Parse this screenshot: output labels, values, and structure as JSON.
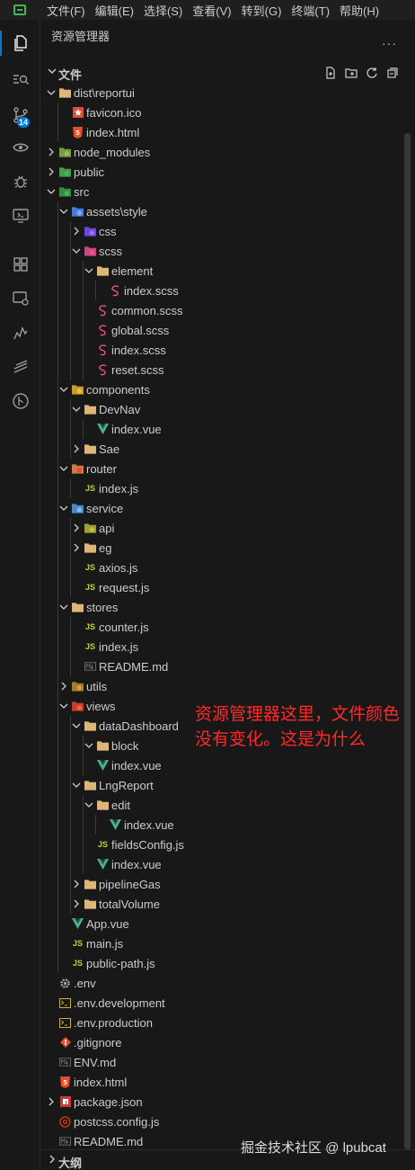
{
  "menubar": {
    "items": [
      "文件(F)",
      "编辑(E)",
      "选择(S)",
      "查看(V)",
      "转到(G)",
      "终端(T)",
      "帮助(H)"
    ]
  },
  "activitybar": {
    "items": [
      {
        "name": "explorer-icon",
        "active": true
      },
      {
        "name": "search-icon"
      },
      {
        "name": "source-control-icon",
        "badge": "14"
      },
      {
        "name": "eye-icon"
      },
      {
        "name": "debug-icon"
      },
      {
        "name": "remote-explorer-icon"
      },
      {
        "name": "extensions-icon"
      },
      {
        "name": "remote-window-icon"
      },
      {
        "name": "chart-icon"
      },
      {
        "name": "layers-icon"
      },
      {
        "name": "git-graph-icon"
      }
    ]
  },
  "sidebar": {
    "title": "资源管理器",
    "more": "···",
    "section_title": "文件",
    "outline_title": "大纲"
  },
  "colors": {
    "accent": "#0078d4",
    "folder": "#dcb67a",
    "vue": "#42b883",
    "js": "#cbcb41",
    "scss": "#f55385",
    "html": "#e44d26",
    "annotation": "#ff2a2a"
  },
  "tree": [
    {
      "label": "dist\\reportui",
      "depth": 0,
      "type": "folder",
      "open": true,
      "icon": "folder"
    },
    {
      "label": "favicon.ico",
      "depth": 1,
      "type": "file",
      "icon": "favicon"
    },
    {
      "label": "index.html",
      "depth": 1,
      "type": "file",
      "icon": "html"
    },
    {
      "label": "node_modules",
      "depth": 0,
      "type": "folder",
      "open": false,
      "icon": "folder-node"
    },
    {
      "label": "public",
      "depth": 0,
      "type": "folder",
      "open": false,
      "icon": "folder-public"
    },
    {
      "label": "src",
      "depth": 0,
      "type": "folder",
      "open": true,
      "icon": "folder-src"
    },
    {
      "label": "assets\\style",
      "depth": 1,
      "type": "folder",
      "open": true,
      "icon": "folder-assets"
    },
    {
      "label": "css",
      "depth": 2,
      "type": "folder",
      "open": false,
      "icon": "folder-css"
    },
    {
      "label": "scss",
      "depth": 2,
      "type": "folder",
      "open": true,
      "icon": "folder-scss"
    },
    {
      "label": "element",
      "depth": 3,
      "type": "folder",
      "open": true,
      "icon": "folder"
    },
    {
      "label": "index.scss",
      "depth": 4,
      "type": "file",
      "icon": "scss"
    },
    {
      "label": "common.scss",
      "depth": 3,
      "type": "file",
      "icon": "scss"
    },
    {
      "label": "global.scss",
      "depth": 3,
      "type": "file",
      "icon": "scss"
    },
    {
      "label": "index.scss",
      "depth": 3,
      "type": "file",
      "icon": "scss"
    },
    {
      "label": "reset.scss",
      "depth": 3,
      "type": "file",
      "icon": "scss"
    },
    {
      "label": "components",
      "depth": 1,
      "type": "folder",
      "open": true,
      "icon": "folder-components"
    },
    {
      "label": "DevNav",
      "depth": 2,
      "type": "folder",
      "open": true,
      "icon": "folder"
    },
    {
      "label": "index.vue",
      "depth": 3,
      "type": "file",
      "icon": "vue"
    },
    {
      "label": "Sae",
      "depth": 2,
      "type": "folder",
      "open": false,
      "icon": "folder"
    },
    {
      "label": "router",
      "depth": 1,
      "type": "folder",
      "open": true,
      "icon": "folder-router"
    },
    {
      "label": "index.js",
      "depth": 2,
      "type": "file",
      "icon": "js"
    },
    {
      "label": "service",
      "depth": 1,
      "type": "folder",
      "open": true,
      "icon": "folder-service"
    },
    {
      "label": "api",
      "depth": 2,
      "type": "folder",
      "open": false,
      "icon": "folder-api"
    },
    {
      "label": "eg",
      "depth": 2,
      "type": "folder",
      "open": false,
      "icon": "folder"
    },
    {
      "label": "axios.js",
      "depth": 2,
      "type": "file",
      "icon": "js"
    },
    {
      "label": "request.js",
      "depth": 2,
      "type": "file",
      "icon": "js"
    },
    {
      "label": "stores",
      "depth": 1,
      "type": "folder",
      "open": true,
      "icon": "folder"
    },
    {
      "label": "counter.js",
      "depth": 2,
      "type": "file",
      "icon": "js"
    },
    {
      "label": "index.js",
      "depth": 2,
      "type": "file",
      "icon": "js"
    },
    {
      "label": "README.md",
      "depth": 2,
      "type": "file",
      "icon": "md"
    },
    {
      "label": "utils",
      "depth": 1,
      "type": "folder",
      "open": false,
      "icon": "folder-utils"
    },
    {
      "label": "views",
      "depth": 1,
      "type": "folder",
      "open": true,
      "icon": "folder-views"
    },
    {
      "label": "dataDashboard",
      "depth": 2,
      "type": "folder",
      "open": true,
      "icon": "folder"
    },
    {
      "label": "block",
      "depth": 3,
      "type": "folder",
      "open": true,
      "icon": "folder"
    },
    {
      "label": "index.vue",
      "depth": 3,
      "type": "file",
      "icon": "vue"
    },
    {
      "label": "LngReport",
      "depth": 2,
      "type": "folder",
      "open": true,
      "icon": "folder"
    },
    {
      "label": "edit",
      "depth": 3,
      "type": "folder",
      "open": true,
      "icon": "folder"
    },
    {
      "label": "index.vue",
      "depth": 4,
      "type": "file",
      "icon": "vue"
    },
    {
      "label": "fieldsConfig.js",
      "depth": 3,
      "type": "file",
      "icon": "js"
    },
    {
      "label": "index.vue",
      "depth": 3,
      "type": "file",
      "icon": "vue"
    },
    {
      "label": "pipelineGas",
      "depth": 2,
      "type": "folder",
      "open": false,
      "icon": "folder"
    },
    {
      "label": "totalVolume",
      "depth": 2,
      "type": "folder",
      "open": false,
      "icon": "folder"
    },
    {
      "label": "App.vue",
      "depth": 1,
      "type": "file",
      "icon": "vue"
    },
    {
      "label": "main.js",
      "depth": 1,
      "type": "file",
      "icon": "js"
    },
    {
      "label": "public-path.js",
      "depth": 1,
      "type": "file",
      "icon": "js"
    },
    {
      "label": ".env",
      "depth": 0,
      "type": "file",
      "icon": "gear"
    },
    {
      "label": ".env.development",
      "depth": 0,
      "type": "file",
      "icon": "terminal"
    },
    {
      "label": ".env.production",
      "depth": 0,
      "type": "file",
      "icon": "terminal"
    },
    {
      "label": ".gitignore",
      "depth": 0,
      "type": "file",
      "icon": "git"
    },
    {
      "label": "ENV.md",
      "depth": 0,
      "type": "file",
      "icon": "md"
    },
    {
      "label": "index.html",
      "depth": 0,
      "type": "file",
      "icon": "html"
    },
    {
      "label": "package.json",
      "depth": 0,
      "type": "folder",
      "open": false,
      "icon": "npm"
    },
    {
      "label": "postcss.config.js",
      "depth": 0,
      "type": "file",
      "icon": "postcss"
    },
    {
      "label": "README.md",
      "depth": 0,
      "type": "file",
      "icon": "md"
    }
  ],
  "annotation": "资源管理器这里，文件颜色没有变化。这是为什么",
  "watermark": "掘金技术社区 @ lpubcat"
}
